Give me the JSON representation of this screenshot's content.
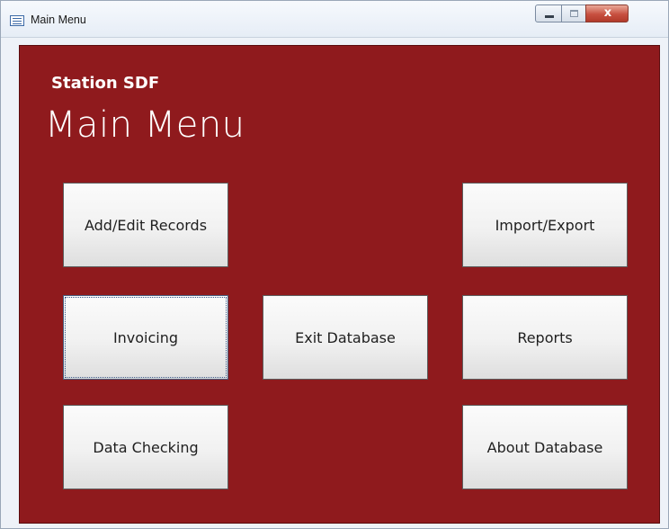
{
  "window": {
    "title": "Main Menu",
    "controls": {
      "minimize_icon": "minimize-icon",
      "maximize_icon": "maximize-icon",
      "close_glyph": "x"
    }
  },
  "form": {
    "subtitle": "Station SDF",
    "heading": "Main Menu",
    "background_color": "#8f1a1d",
    "buttons": {
      "add_edit": "Add/Edit Records",
      "import_export": "Import/Export",
      "invoicing": "Invoicing",
      "exit_database": "Exit Database",
      "reports": "Reports",
      "data_checking": "Data Checking",
      "about_database": "About Database"
    },
    "focused_button": "invoicing"
  }
}
